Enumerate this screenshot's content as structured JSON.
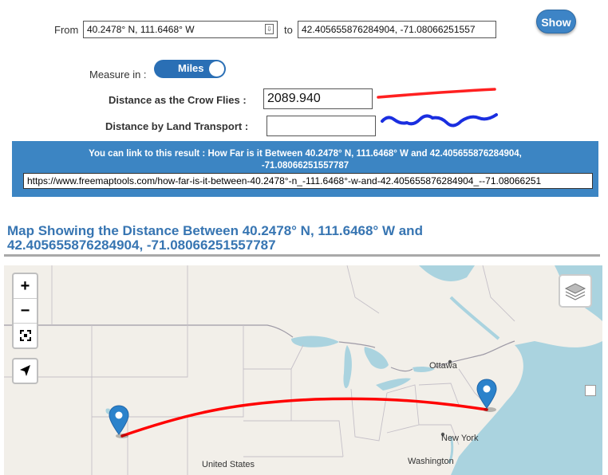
{
  "form": {
    "from_label": "From",
    "from_value": "40.2478° N, 111.6468° W",
    "to_label": "to",
    "to_value": "42.405655876284904, -71.08066251557",
    "show_label": "Show",
    "measure_label": "Measure in :",
    "measure_value": "Miles",
    "crow_label": "Distance as the Crow Flies :",
    "crow_value": "2089.940",
    "land_label": "Distance by Land Transport :",
    "land_value": ""
  },
  "link_banner": {
    "text_prefix": "You can ",
    "link_text": "link to this result",
    "text_rest": " : How Far is it Between 40.2478° N, 111.6468° W and 42.405655876284904, -71.08066251557787",
    "url": "https://www.freemaptools.com/how-far-is-it-between-40.2478°-n_-111.6468°-w-and-42.405655876284904_--71.08066251"
  },
  "map": {
    "heading": "Map Showing the Distance Between 40.2478° N, 111.6468° W and 42.405655876284904, -71.08066251557787",
    "zoom_in": "+",
    "zoom_out": "−",
    "labels": {
      "ottawa": "Ottawa",
      "new_york": "New York",
      "washington": "Washington",
      "united_states": "United States"
    },
    "route_color": "#ff0000",
    "marker_color": "#2b82cb"
  },
  "colors": {
    "accent": "#3c85c3",
    "heading": "#3775b2",
    "crow_line": "#ff2020",
    "land_line": "#1a2ee0"
  }
}
